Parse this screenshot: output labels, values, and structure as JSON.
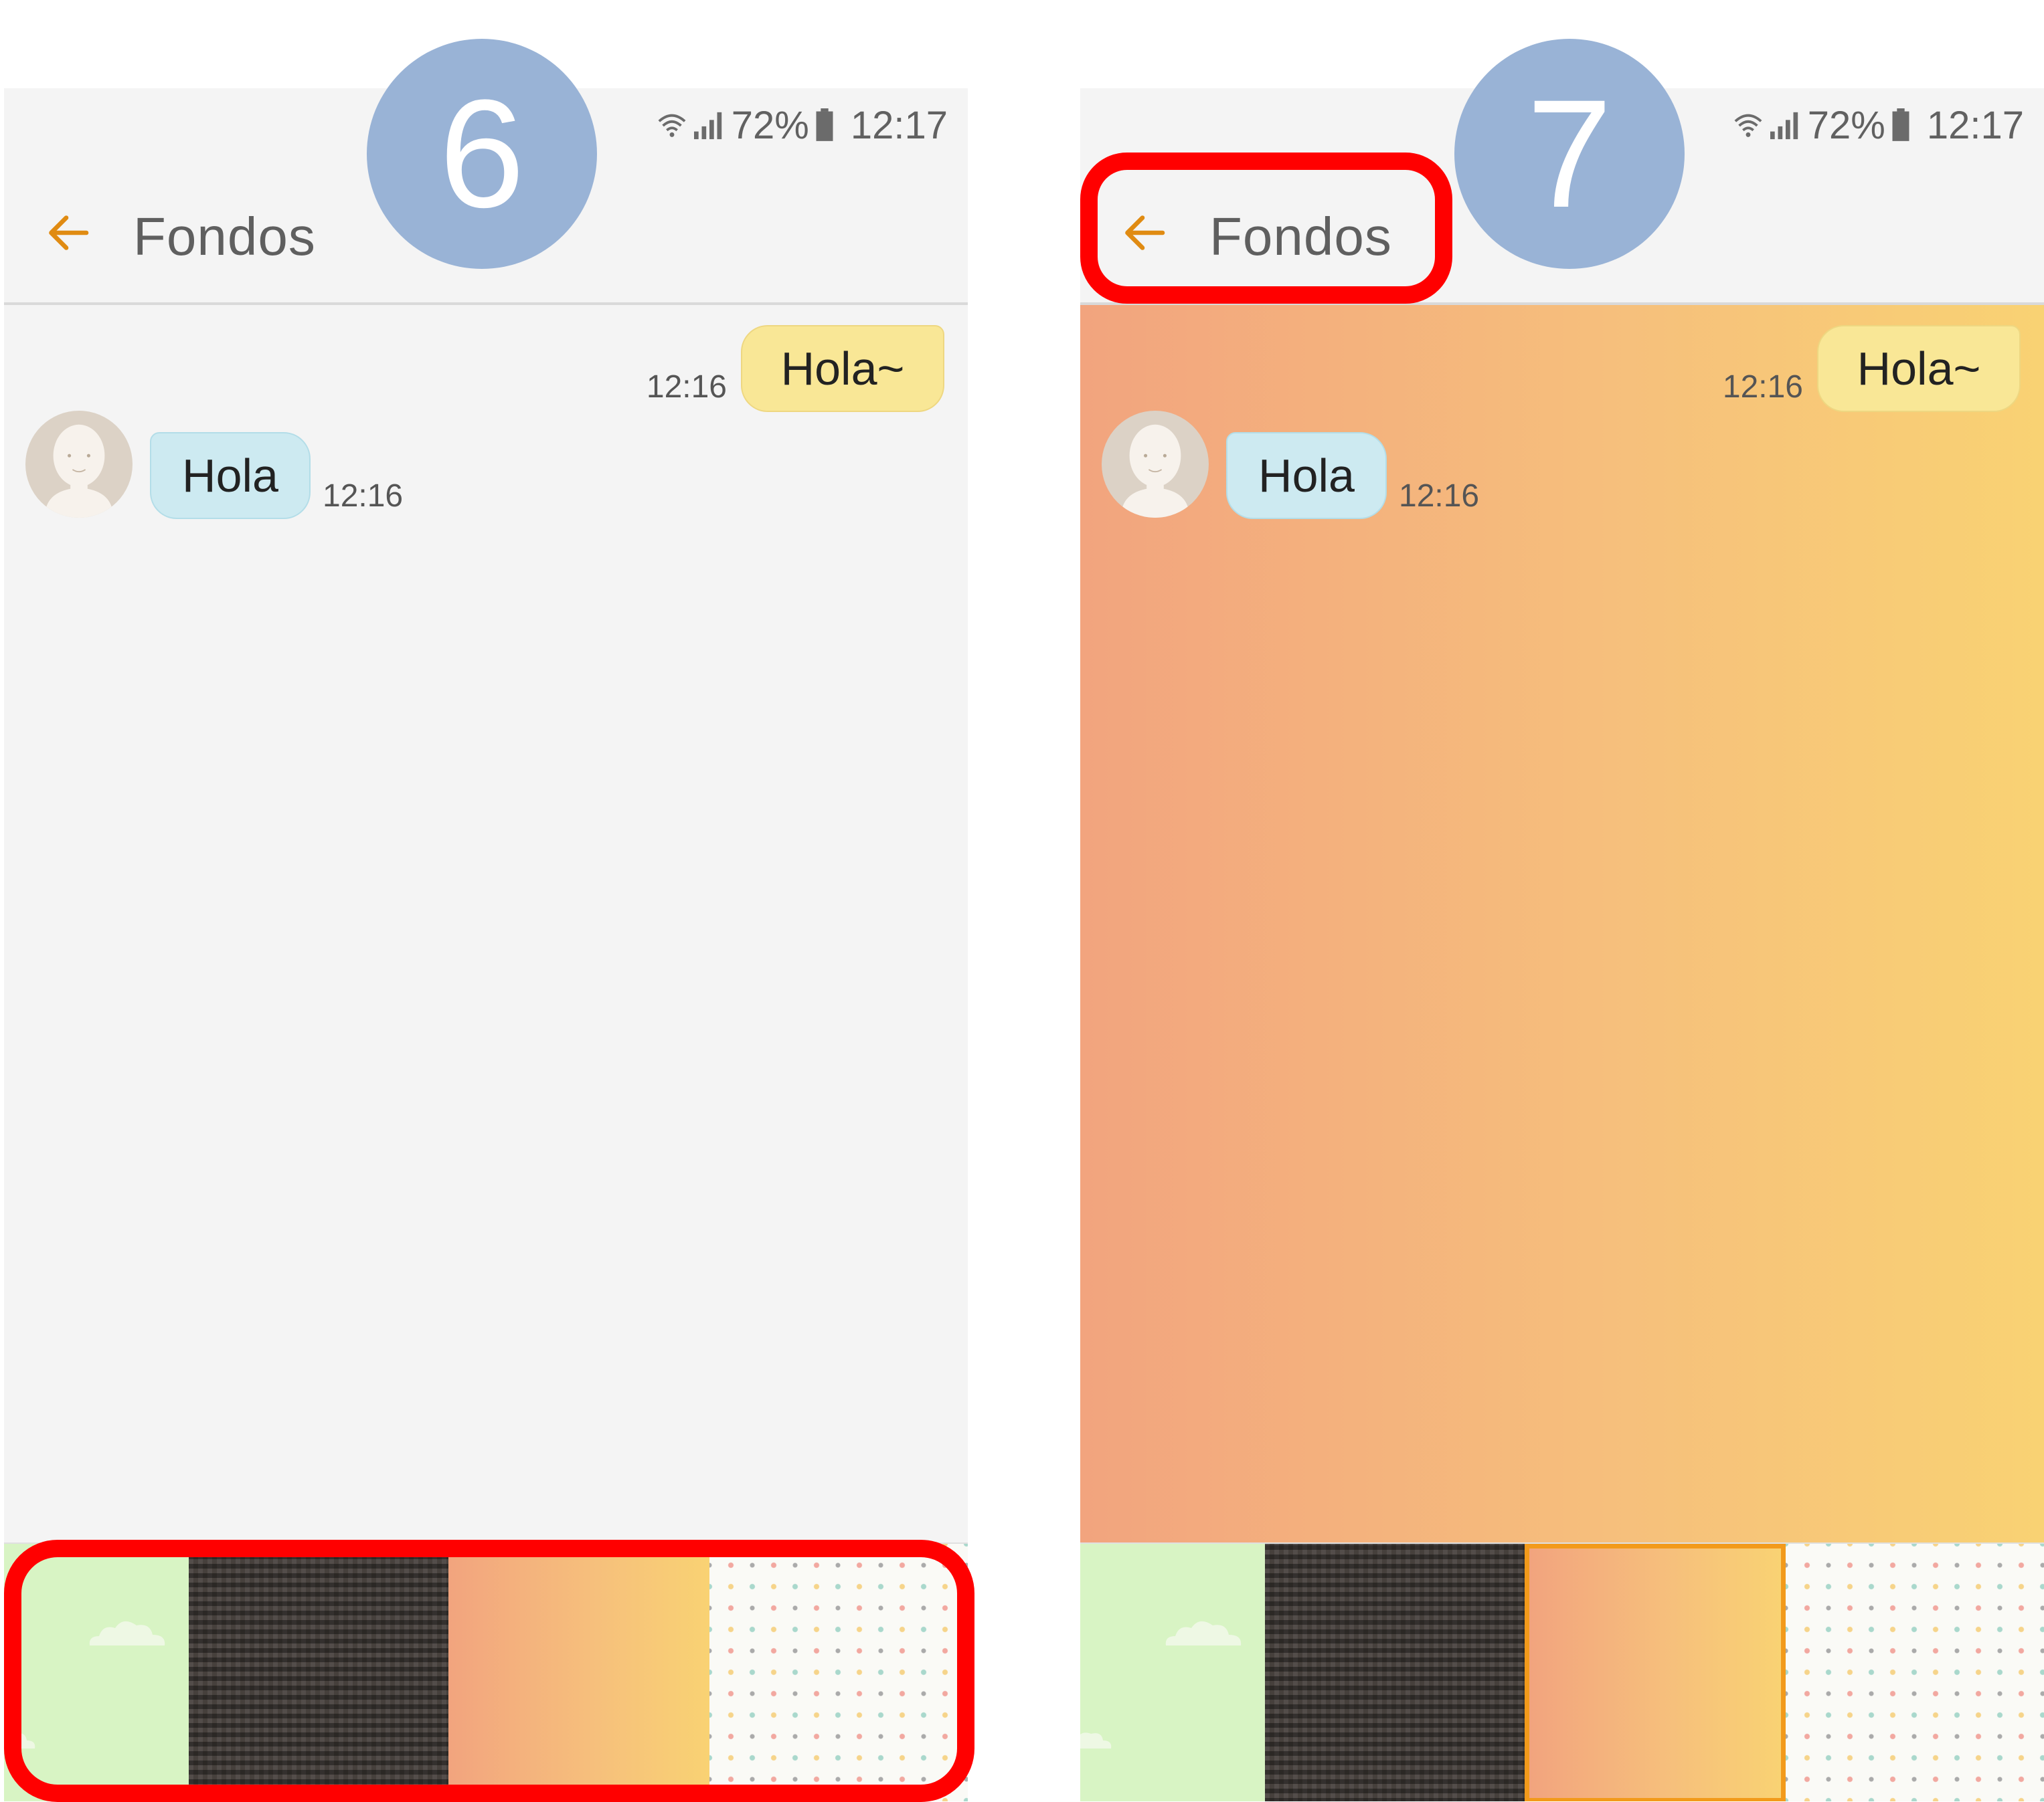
{
  "status_bar": {
    "battery_percent": "72%",
    "clock": "12:17"
  },
  "app_bar": {
    "title": "Fondos"
  },
  "conversation": {
    "outgoing": {
      "text": "Hola~",
      "time": "12:16"
    },
    "incoming": {
      "text": "Hola",
      "time": "12:16"
    }
  },
  "wallpapers": [
    {
      "name": "green-clouds"
    },
    {
      "name": "dark-plaid"
    },
    {
      "name": "orange-yellow-gradient"
    },
    {
      "name": "polka-dots"
    }
  ],
  "steps": {
    "first": "6",
    "second": "7"
  },
  "colors": {
    "accent": "#f29a1b",
    "highlight": "#ff0000",
    "badge": "#99b3d6",
    "outgoing_bubble": "#f9e796",
    "incoming_bubble": "#cdeaf1",
    "gradient_start": "#f2a47e",
    "gradient_end": "#f9d273"
  },
  "icons": [
    "wifi-icon",
    "signal-icon",
    "battery-icon",
    "back-arrow-icon",
    "avatar-icon"
  ]
}
